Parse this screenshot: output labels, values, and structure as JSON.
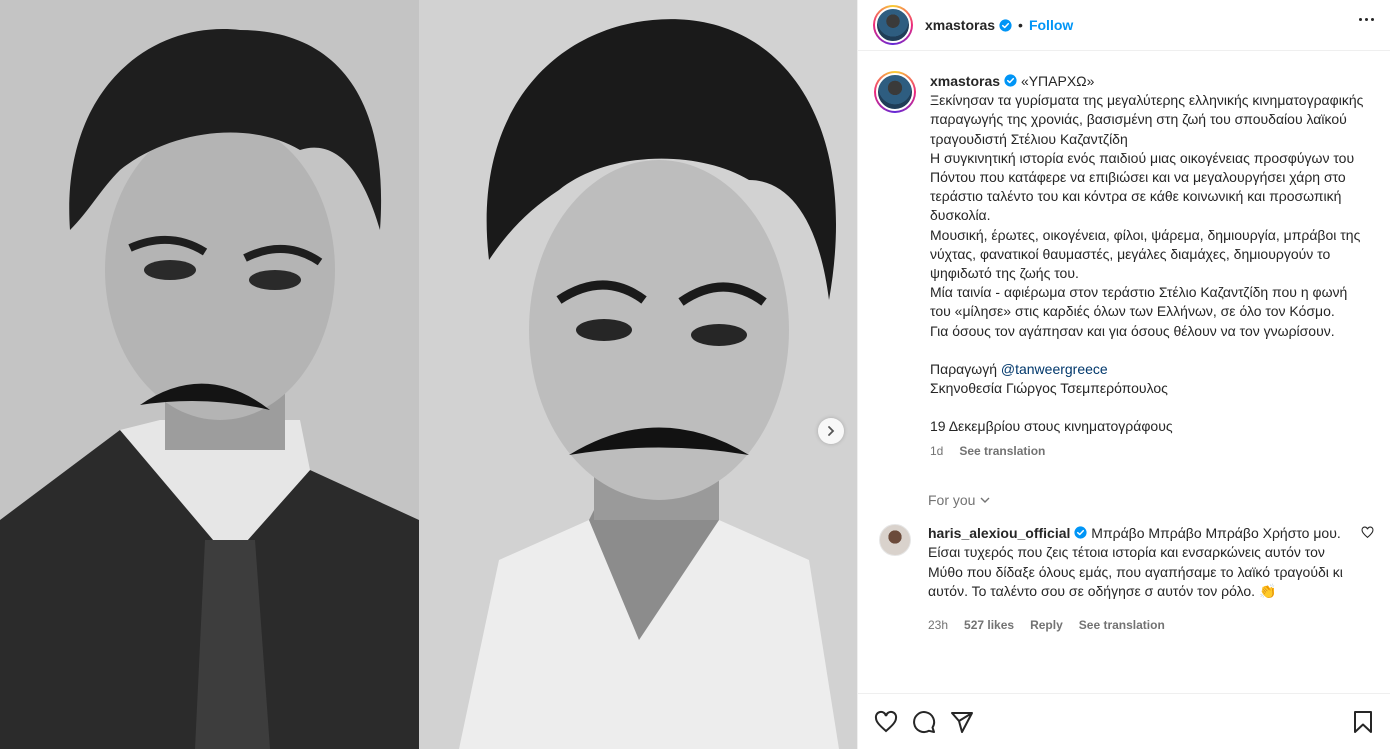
{
  "header": {
    "username": "xmastoras",
    "separator": "•",
    "follow_label": "Follow"
  },
  "caption": {
    "username": "xmastoras",
    "title": "«ΥΠΑΡΧΩ»",
    "paragraphs": [
      "Ξεκίνησαν τα γυρίσματα της μεγαλύτερης ελληνικής κινηματογραφικής παραγωγής της χρονιάς, βασισμένη στη ζωή του σπουδαίου λαϊκού τραγουδιστή Στέλιου Καζαντζίδη",
      "Η συγκινητική ιστορία ενός παιδιού μιας οικογένειας προσφύγων του Πόντου που κατάφερε να επιβιώσει και να μεγαλουργήσει χάρη στο τεράστιο ταλέντο του και κόντρα σε κάθε κοινωνική και προσωπική δυσκολία.",
      "Μουσική, έρωτες, οικογένεια, φίλοι, ψάρεμα, δημιουργία, μπράβοι της νύχτας, φανατικοί θαυμαστές, μεγάλες διαμάχες, δημιουργούν το ψηφιδωτό της ζωής του.",
      "Μία ταινία - αφιέρωμα στον τεράστιο Στέλιο Καζαντζίδη που η φωνή του «μίλησε» στις καρδιές όλων των Ελλήνων, σε όλο τον Κόσμο.",
      "Για όσους τον αγάπησαν και για όσους θέλουν να τον γνωρίσουν."
    ],
    "production_label": "Παραγωγή",
    "production_link": "@tanweergreece",
    "direction": "Σκηνοθεσία Γιώργος Τσεμπερόπουλος",
    "release": "19 Δεκεμβρίου στους κινηματογράφους",
    "time": "1d",
    "see_translation": "See translation"
  },
  "for_you": {
    "label": "For you"
  },
  "comment": {
    "username": "haris_alexiou_official",
    "text": "Μπράβο Μπράβο Μπράβο Χρήστο μου. Είσαι τυχερός που ζεις τέτοια ιστορία και ενσαρκώνεις αυτόν τον Μύθο που δίδαξε όλους εμάς, που αγαπήσαμε το λαϊκό τραγούδι κι αυτόν. Το ταλέντο σου σε οδήγησε σ αυτόν τον ρόλο.",
    "emoji": "👏",
    "time": "23h",
    "likes": "527 likes",
    "reply": "Reply",
    "see_translation": "See translation"
  },
  "colors": {
    "accent": "#0095f6",
    "verified": "#0095f6",
    "link": "#00376b",
    "muted": "#737373"
  },
  "icons": [
    "verified-icon",
    "more-icon",
    "next-arrow-icon",
    "chevron-down-icon",
    "heart-icon",
    "comment-icon",
    "share-icon",
    "bookmark-icon"
  ]
}
